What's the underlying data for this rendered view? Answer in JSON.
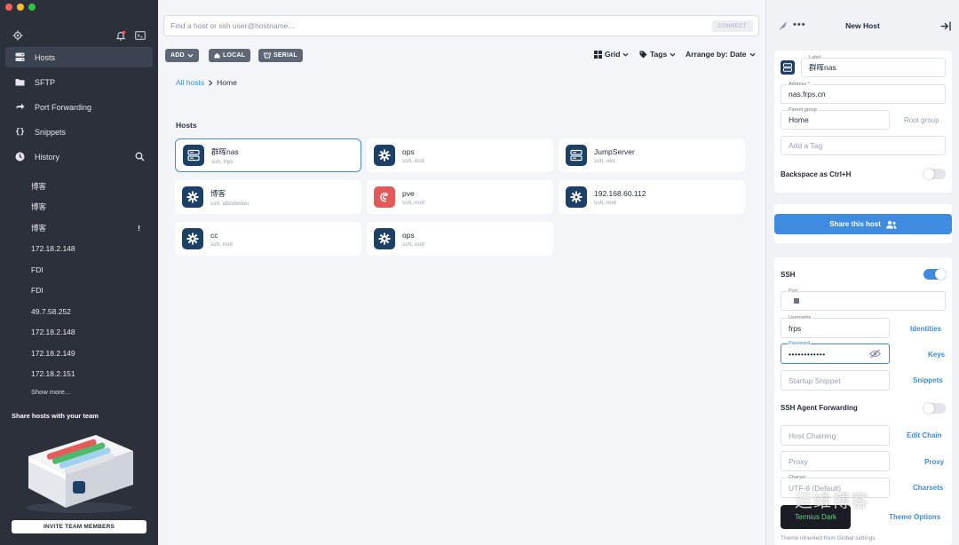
{
  "sidebar": {
    "nav": [
      {
        "label": "Hosts",
        "icon": "server-icon",
        "active": true
      },
      {
        "label": "SFTP",
        "icon": "folder-icon"
      },
      {
        "label": "Port Forwarding",
        "icon": "arrow-right-icon"
      },
      {
        "label": "Snippets",
        "icon": "braces-icon"
      },
      {
        "label": "History",
        "icon": "clock-icon"
      }
    ],
    "history": [
      "博客",
      "博客",
      "博客",
      "172.18.2.148",
      "FDI",
      "FDI",
      "49.7.58.252",
      "172.18.2.148",
      "172.18.2.149",
      "172.18.2.151"
    ],
    "history_warn": "!",
    "show_more": "Show more...",
    "share_title": "Share hosts with your team",
    "invite": "INVITE TEAM MEMBERS"
  },
  "main": {
    "search_placeholder": "Find a host or ssh user@hostname...",
    "connect": "CONNECT",
    "toolbar": {
      "add": "ADD",
      "local": "LOCAL",
      "serial": "SERIAL",
      "grid": "Grid",
      "tags": "Tags",
      "arrange": "Arrange by: Date"
    },
    "breadcrumb": {
      "root": "All hosts",
      "current": "Home"
    },
    "section": "Hosts",
    "hosts": [
      {
        "name": "群晖nas",
        "sub": "ssh, frps",
        "icon": "server-icon"
      },
      {
        "name": "ops",
        "sub": "ssh, root",
        "icon": "gear-icon"
      },
      {
        "name": "JumpServer",
        "sub": "ssh, ukx",
        "icon": "server-icon"
      },
      {
        "name": "博客",
        "sub": "ssh, abcdocker",
        "icon": "gear-icon"
      },
      {
        "name": "pve",
        "sub": "ssh, root",
        "icon": "debian-icon"
      },
      {
        "name": "192.168.60.112",
        "sub": "ssh, root",
        "icon": "gear-icon"
      },
      {
        "name": "cc",
        "sub": "ssh, root",
        "icon": "gear-icon"
      },
      {
        "name": "ops",
        "sub": "ssh, root",
        "icon": "gear-icon"
      }
    ]
  },
  "panel": {
    "title": "New Host",
    "label_caption": "Label",
    "label_value": "群晖nas",
    "address_caption": "Address *",
    "address_value": "nas.frps.cn",
    "parent_caption": "Parent group",
    "parent_value": "Home",
    "root_group": "Root group",
    "tag_placeholder": "Add a Tag",
    "backspace": "Backspace as Ctrl+H",
    "share": "Share this host",
    "ssh": "SSH",
    "port_caption": "Port",
    "username_caption": "Username",
    "username_value": "frps",
    "identities": "Identities",
    "password_caption": "Password",
    "password_value": "••••••••••••",
    "keys": "Keys",
    "startup_placeholder": "Startup Snippet",
    "snippets": "Snippets",
    "agent_forwarding": "SSH Agent Forwarding",
    "chaining_placeholder": "Host Chaining",
    "edit_chain": "Edit Chain",
    "proxy_placeholder": "Proxy",
    "proxy_link": "Proxy",
    "charset_caption": "Charset",
    "charset_value": "UTF-8 (Default)",
    "charsets": "Charsets",
    "theme": "Termius Dark",
    "theme_options": "Theme Options",
    "theme_note": "Theme inherited from Global settings"
  },
  "watermark": "运维博客",
  "colors": {
    "accent": "#3f8be0",
    "sidebar": "#2b303b",
    "host_icon": "#1d4166",
    "debian": "#e2595a"
  }
}
